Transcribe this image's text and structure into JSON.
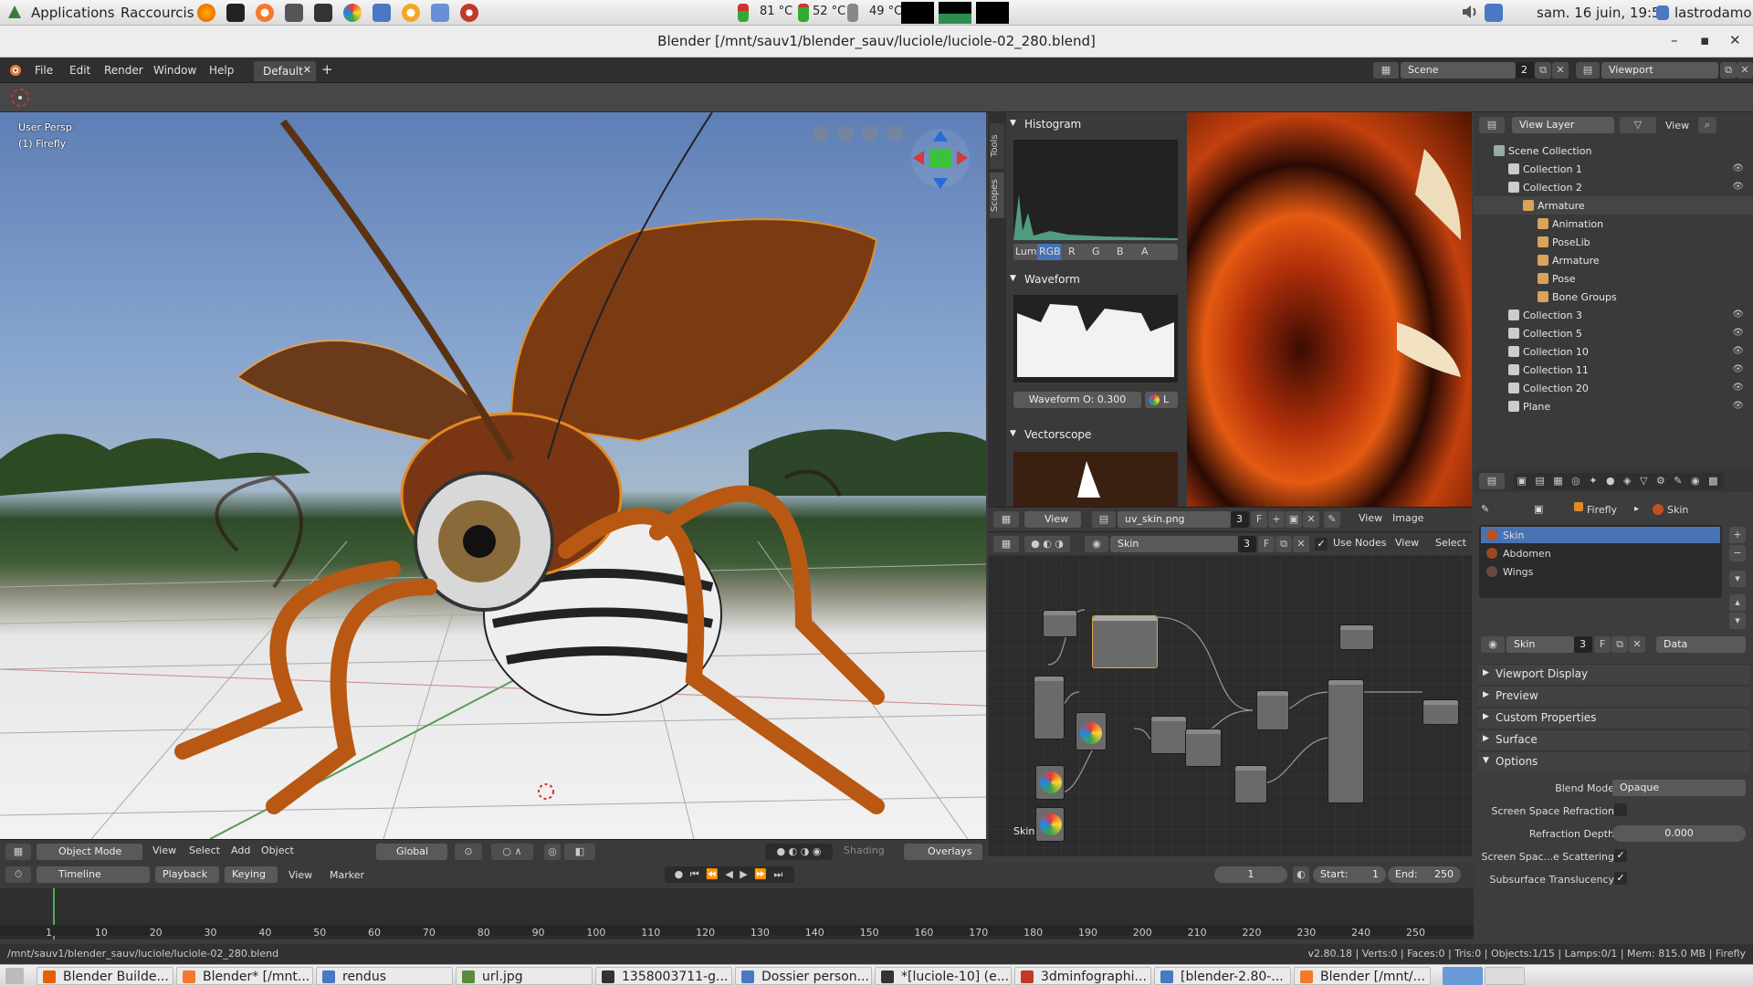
{
  "os": {
    "applications": "Applications",
    "raccourcis": "Raccourcis",
    "temps": [
      "81 °C",
      "52 °C",
      "49 °C"
    ],
    "clock": "sam. 16 juin, 19:51",
    "user": "lastrodamo"
  },
  "window": {
    "title": "Blender [/mnt/sauv1/blender_sauv/luciole/luciole-02_280.blend]",
    "minimize": "–",
    "maximize": "▪",
    "close": "✕"
  },
  "topbar": {
    "menus": [
      "File",
      "Edit",
      "Render",
      "Window",
      "Help"
    ],
    "workspace_tab": "Default",
    "scene_label": "Scene",
    "scene_count": "2",
    "viewport_label": "Viewport"
  },
  "viewport": {
    "persp": "User Persp",
    "object": "(1) Firefly",
    "header": {
      "mode": "Object Mode",
      "view": "View",
      "select": "Select",
      "add": "Add",
      "object": "Object",
      "orientation": "Global",
      "shading": "Shading",
      "overlays": "Overlays"
    }
  },
  "scopes": {
    "side_tabs": [
      "Tools",
      "Scopes"
    ],
    "histogram": "Histogram",
    "channels": [
      "Lum",
      "RGB",
      "R",
      "G",
      "B",
      "A"
    ],
    "waveform": "Waveform",
    "waveform_opacity": "Waveform O: 0.300",
    "waveform_mode": "L",
    "vectorscope": "Vectorscope"
  },
  "image_editor": {
    "view": "View",
    "image_name": "uv_skin.png",
    "users": "3",
    "fake": "F",
    "menu_view": "View",
    "menu_image": "Image"
  },
  "node_editor": {
    "material": "Skin",
    "users": "3",
    "fake": "F",
    "use_nodes": "Use Nodes",
    "view": "View",
    "select": "Select",
    "frame_label": "Skin"
  },
  "outliner": {
    "view_layer": "View Layer",
    "view": "View",
    "rows": [
      {
        "label": "Scene Collection",
        "indent": 0
      },
      {
        "label": "Collection 1",
        "indent": 1
      },
      {
        "label": "Collection 2",
        "indent": 1
      },
      {
        "label": "Armature",
        "indent": 2
      },
      {
        "label": "Animation",
        "indent": 3
      },
      {
        "label": "PoseLib",
        "indent": 3
      },
      {
        "label": "Armature",
        "indent": 3
      },
      {
        "label": "Pose",
        "indent": 3
      },
      {
        "label": "Bone Groups",
        "indent": 3
      },
      {
        "label": "Collection 3",
        "indent": 1
      },
      {
        "label": "Collection 5",
        "indent": 1
      },
      {
        "label": "Collection 10",
        "indent": 1
      },
      {
        "label": "Collection 11",
        "indent": 1
      },
      {
        "label": "Collection 20",
        "indent": 1
      },
      {
        "label": "Plane",
        "indent": 1
      }
    ]
  },
  "properties": {
    "breadcrumb": [
      "Firefly",
      "Skin"
    ],
    "materials": [
      "Skin",
      "Abdomen",
      "Wings"
    ],
    "material_name": "Skin",
    "users": "3",
    "fake": "F",
    "link": "Data",
    "panels": [
      "Viewport Display",
      "Preview",
      "Custom Properties",
      "Surface",
      "Options"
    ],
    "options": {
      "blend_mode_label": "Blend Mode",
      "blend_mode": "Opaque",
      "ssr_label": "Screen Space Refraction",
      "refraction_depth_label": "Refraction Depth",
      "refraction_depth": "0.000",
      "sss_label": "Screen Spac...e Scattering",
      "translucency_label": "Subsurface Translucency"
    }
  },
  "timeline": {
    "editor": "Timeline",
    "playback": "Playback",
    "keying": "Keying",
    "view": "View",
    "marker": "Marker",
    "current_frame": "1",
    "start_label": "Start:",
    "start": "1",
    "end_label": "End:",
    "end": "250",
    "ticks": [
      "1",
      "10",
      "20",
      "30",
      "40",
      "50",
      "60",
      "70",
      "80",
      "90",
      "100",
      "110",
      "120",
      "130",
      "140",
      "150",
      "160",
      "170",
      "180",
      "190",
      "200",
      "210",
      "220",
      "230",
      "240",
      "250"
    ]
  },
  "status": {
    "path": "/mnt/sauv1/blender_sauv/luciole/luciole-02_280.blend",
    "stats": "v2.80.18 | Verts:0 | Faces:0 | Tris:0 | Objects:1/15 | Lamps:0/1 | Mem: 815.0 MB | Firefly"
  },
  "taskbar": [
    {
      "label": "Blender Builde...",
      "color": "#e66000"
    },
    {
      "label": "Blender* [/mnt...",
      "color": "#f5792a"
    },
    {
      "label": "rendus",
      "color": "#4a78c2"
    },
    {
      "label": "url.jpg",
      "color": "#5a8a3a"
    },
    {
      "label": "1358003711-g...",
      "color": "#333333"
    },
    {
      "label": "Dossier person...",
      "color": "#4a78c2"
    },
    {
      "label": "*[luciole-10] (e...",
      "color": "#333333"
    },
    {
      "label": "3dminfographi...",
      "color": "#c0392b"
    },
    {
      "label": "[blender-2.80-...",
      "color": "#4a78c2"
    },
    {
      "label": "Blender [/mnt/...",
      "color": "#f5792a"
    }
  ]
}
